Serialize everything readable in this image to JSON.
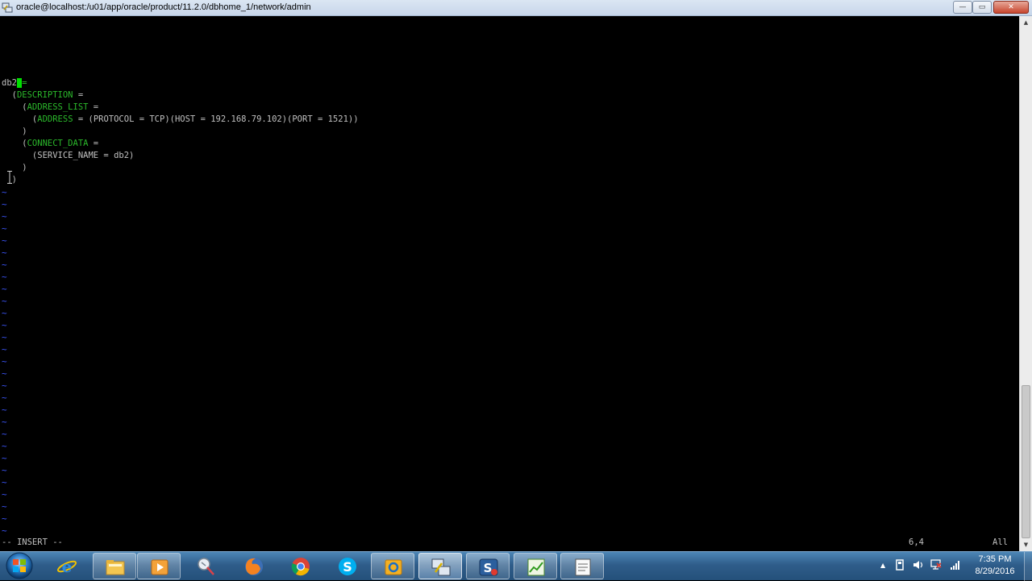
{
  "window": {
    "title": "oracle@localhost:/u01/app/oracle/product/11.2.0/dbhome_1/network/admin",
    "minimize_label": "—",
    "maximize_label": "▭",
    "close_label": "✕"
  },
  "editor": {
    "lines": [
      {
        "segments": [
          {
            "t": "db2",
            "c": "tx"
          },
          {
            "t": " ",
            "c": "cur"
          },
          {
            "t": "=",
            "c": "kw"
          }
        ]
      },
      {
        "segments": [
          {
            "t": "  (",
            "c": "tx"
          },
          {
            "t": "DESCRIPTION",
            "c": "kw"
          },
          {
            "t": " =",
            "c": "tx"
          }
        ]
      },
      {
        "segments": [
          {
            "t": "    (",
            "c": "tx"
          },
          {
            "t": "ADDRESS_LIST",
            "c": "kw"
          },
          {
            "t": " =",
            "c": "tx"
          }
        ]
      },
      {
        "segments": [
          {
            "t": "      (",
            "c": "tx"
          },
          {
            "t": "ADDRESS",
            "c": "kw"
          },
          {
            "t": " = (PROTOCOL = TCP)(HOST = 192.168.79.102)(PORT = 1521))",
            "c": "tx"
          }
        ]
      },
      {
        "segments": [
          {
            "t": "    )",
            "c": "tx"
          }
        ]
      },
      {
        "segments": [
          {
            "t": "    (",
            "c": "tx"
          },
          {
            "t": "CONNECT_DATA",
            "c": "kw"
          },
          {
            "t": " =",
            "c": "tx"
          }
        ]
      },
      {
        "segments": [
          {
            "t": "      (SERVICE_NAME = db2)",
            "c": "tx"
          }
        ]
      },
      {
        "segments": [
          {
            "t": "    )",
            "c": "tx"
          }
        ]
      },
      {
        "segments": [
          {
            "t": "  )",
            "c": "tx"
          }
        ]
      }
    ],
    "tilde_char": "~",
    "tilde_count": 29,
    "mode": "-- INSERT --",
    "cursor_position": "6,4",
    "scroll_position": "All"
  },
  "scrollbar": {
    "up_arrow": "▲",
    "down_arrow": "▼"
  },
  "taskbar": {
    "items": [
      {
        "name": "internet-explorer",
        "state": "closed"
      },
      {
        "name": "windows-explorer",
        "state": "open"
      },
      {
        "name": "media-player",
        "state": "open"
      },
      {
        "name": "snipping-tool",
        "state": "closed"
      },
      {
        "name": "firefox",
        "state": "closed"
      },
      {
        "name": "chrome",
        "state": "closed"
      },
      {
        "name": "skype",
        "state": "closed"
      },
      {
        "name": "outlook",
        "state": "open"
      },
      {
        "name": "putty",
        "state": "active"
      },
      {
        "name": "screencast-app",
        "state": "open"
      },
      {
        "name": "spreadsheet-app",
        "state": "open"
      },
      {
        "name": "document-app",
        "state": "open"
      }
    ],
    "tray": {
      "arrow": "▲"
    },
    "clock": {
      "time": "7:35 PM",
      "date": "8/29/2016"
    }
  },
  "colors": {
    "keyword": "#2bb92b",
    "text": "#c0c0c0",
    "cursor": "#00e000",
    "tilde": "#3d57ff",
    "background": "#000000"
  }
}
